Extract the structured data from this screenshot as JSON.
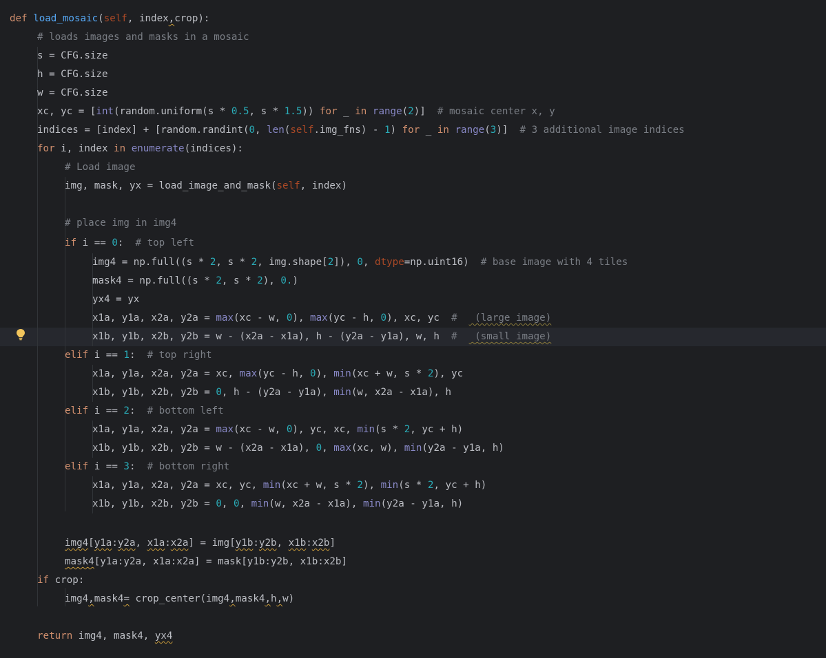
{
  "editor": {
    "intention_icon": "lightbulb-icon",
    "lines": {
      "l01": "def load_mosaic(self, index,crop):",
      "l02": "# loads images and masks in a mosaic",
      "l03": "s = CFG.size",
      "l04": "h = CFG.size",
      "l05": "w = CFG.size",
      "l06": "xc, yc = [int(random.uniform(s * 0.5, s * 1.5)) for _ in range(2)]  # mosaic center x, y",
      "l07": "indices = [index] + [random.randint(0, len(self.img_fns) - 1) for _ in range(3)]  # 3 additional image indices",
      "l08": "for i, index in enumerate(indices):",
      "l09": "# Load image",
      "l10": "img, mask, yx = load_image_and_mask(self, index)",
      "l11": "# place img in img4",
      "l12": "if i == 0:  # top left",
      "l13": "img4 = np.full((s * 2, s * 2, img.shape[2]), 0, dtype=np.uint16)  # base image with 4 tiles",
      "l14": "mask4 = np.full((s * 2, s * 2), 0.)",
      "l15": "yx4 = yx",
      "l16": "x1a, y1a, x2a, y2a = max(xc - w, 0), max(yc - h, 0), xc, yc  #   (large image)",
      "l17": "x1b, y1b, x2b, y2b = w - (x2a - x1a), h - (y2a - y1a), w, h  #   (small image)",
      "l18": "elif i == 1:  # top right",
      "l19": "x1a, y1a, x2a, y2a = xc, max(yc - h, 0), min(xc + w, s * 2), yc",
      "l20": "x1b, y1b, x2b, y2b = 0, h - (y2a - y1a), min(w, x2a - x1a), h",
      "l21": "elif i == 2:  # bottom left",
      "l22": "x1a, y1a, x2a, y2a = max(xc - w, 0), yc, xc, min(s * 2, yc + h)",
      "l23": "x1b, y1b, x2b, y2b = w - (x2a - x1a), 0, max(xc, w), min(y2a - y1a, h)",
      "l24": "elif i == 3:  # bottom right",
      "l25": "x1a, y1a, x2a, y2a = xc, yc, min(xc + w, s * 2), min(s * 2, yc + h)",
      "l26": "x1b, y1b, x2b, y2b = 0, 0, min(w, x2a - x1a), min(y2a - y1a, h)",
      "l27": "img4[y1a:y2a, x1a:x2a] = img[y1b:y2b, x1b:x2b]",
      "l28": "mask4[y1a:y2a, x1a:x2a] = mask[y1b:y2b, x1b:x2b]",
      "l29": "if crop:",
      "l30": "img4,mask4= crop_center(img4,mask4,h,w)",
      "l31": "return img4, mask4, yx4"
    }
  },
  "colors": {
    "background": "#1e1f22",
    "keyword": "#cf8e6d",
    "function": "#56a8f5",
    "builtin": "#8888c6",
    "number": "#2aacb8",
    "comment": "#7a7e85",
    "parameter": "#aa4926"
  }
}
